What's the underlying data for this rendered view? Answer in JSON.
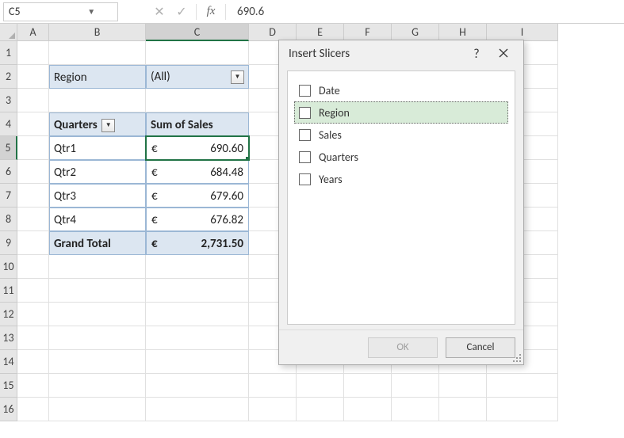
{
  "name_box": "C5",
  "formula_value": "690.6",
  "columns": [
    "A",
    "B",
    "C",
    "D",
    "E",
    "F",
    "G",
    "H",
    "I"
  ],
  "rows": [
    "1",
    "2",
    "3",
    "4",
    "5",
    "6",
    "7",
    "8",
    "9",
    "10",
    "11",
    "12",
    "13",
    "14",
    "15",
    "16"
  ],
  "selected_col": "C",
  "selected_row": "5",
  "pivot": {
    "filter_label": "Region",
    "filter_value": "(All)",
    "row_header": "Quarters",
    "value_header": "Sum of Sales",
    "rows": [
      {
        "label": "Qtr1",
        "currency": "€",
        "value": "690.60"
      },
      {
        "label": "Qtr2",
        "currency": "€",
        "value": "684.48"
      },
      {
        "label": "Qtr3",
        "currency": "€",
        "value": "679.60"
      },
      {
        "label": "Qtr4",
        "currency": "€",
        "value": "676.82"
      }
    ],
    "total_label": "Grand Total",
    "total_currency": "€",
    "total_value": "2,731.50"
  },
  "dialog": {
    "title": "Insert Slicers",
    "help": "?",
    "fields": [
      "Date",
      "Region",
      "Sales",
      "Quarters",
      "Years"
    ],
    "selected_index": 1,
    "ok_label": "OK",
    "cancel_label": "Cancel"
  }
}
